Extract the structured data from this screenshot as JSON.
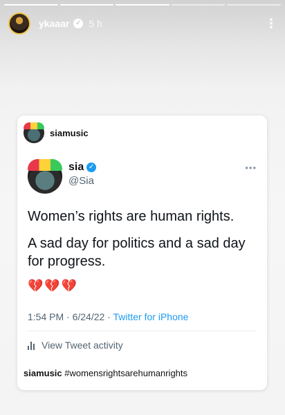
{
  "story": {
    "segments_total": 5,
    "segments_done": 3,
    "username": "ykaaar",
    "time_ago": "5 h",
    "more_icon": "more-vertical-icon"
  },
  "card": {
    "account": "siamusic",
    "tweet": {
      "name": "sia",
      "handle": "@Sia",
      "line1": "Women’s rights are human rights.",
      "line2": "A sad day for politics and a sad day for progress.",
      "emojis": "💔💔💔",
      "time": "1:54 PM · 6/24/22 · ",
      "source": "Twitter for iPhone",
      "activity": "View Tweet activity"
    },
    "caption_user": "siamusic",
    "caption_text": " #womensrightsarehumanrights"
  },
  "colors": {
    "twitter_blue": "#1d9bf0",
    "muted_text": "#536471"
  }
}
